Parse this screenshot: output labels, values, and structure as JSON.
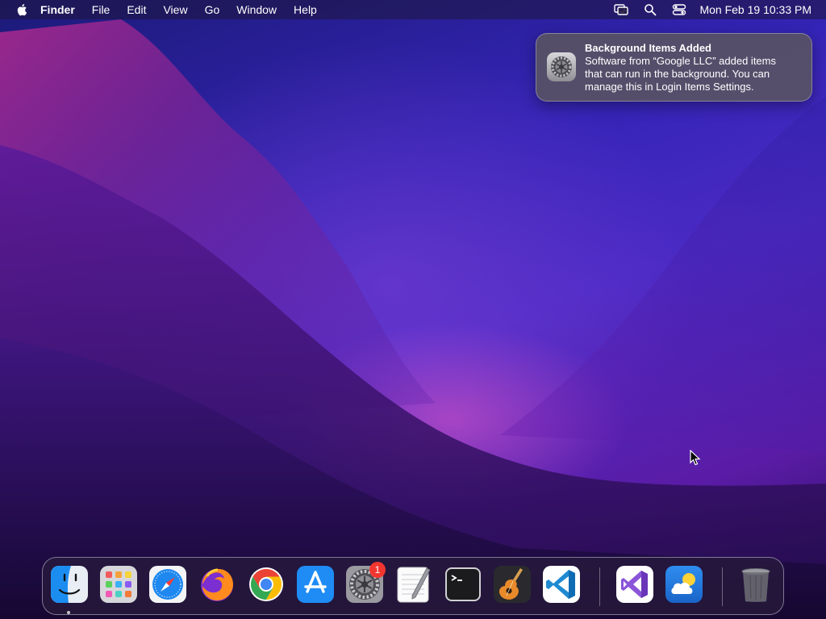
{
  "menubar": {
    "app_name": "Finder",
    "items": [
      "File",
      "Edit",
      "View",
      "Go",
      "Window",
      "Help"
    ],
    "status_icons": [
      "screen-mirroring-icon",
      "spotlight-search-icon",
      "control-center-icon"
    ],
    "clock": "Mon Feb 19  10:33 PM"
  },
  "notification": {
    "title": "Background Items Added",
    "body": "Software from “Google LLC” added items\nthat can run in the background. You can\nmanage this in Login Items Settings.",
    "icon": "system-settings-gear-icon"
  },
  "dock": {
    "apps": [
      {
        "name": "Finder",
        "icon": "finder-icon",
        "running": true
      },
      {
        "name": "Launchpad",
        "icon": "launchpad-icon"
      },
      {
        "name": "Safari",
        "icon": "safari-icon"
      },
      {
        "name": "Firefox",
        "icon": "firefox-icon"
      },
      {
        "name": "Google Chrome",
        "icon": "chrome-icon"
      },
      {
        "name": "App Store",
        "icon": "app-store-icon"
      },
      {
        "name": "System Settings",
        "icon": "system-settings-icon",
        "badge": "1"
      },
      {
        "name": "TextEdit",
        "icon": "textedit-icon"
      },
      {
        "name": "Terminal",
        "icon": "terminal-icon"
      },
      {
        "name": "GarageBand",
        "icon": "garageband-icon"
      },
      {
        "name": "Visual Studio Code",
        "icon": "vscode-icon"
      },
      {
        "name": "Visual Studio",
        "icon": "visual-studio-icon"
      },
      {
        "name": "Weather",
        "icon": "weather-icon"
      },
      {
        "name": "Trash",
        "icon": "trash-icon"
      }
    ]
  },
  "colors": {
    "menubar_text": "#ffffff",
    "badge": "#f2362f",
    "wallpaper_primary": "#3424b6",
    "wallpaper_glow": "#e65ac8"
  }
}
